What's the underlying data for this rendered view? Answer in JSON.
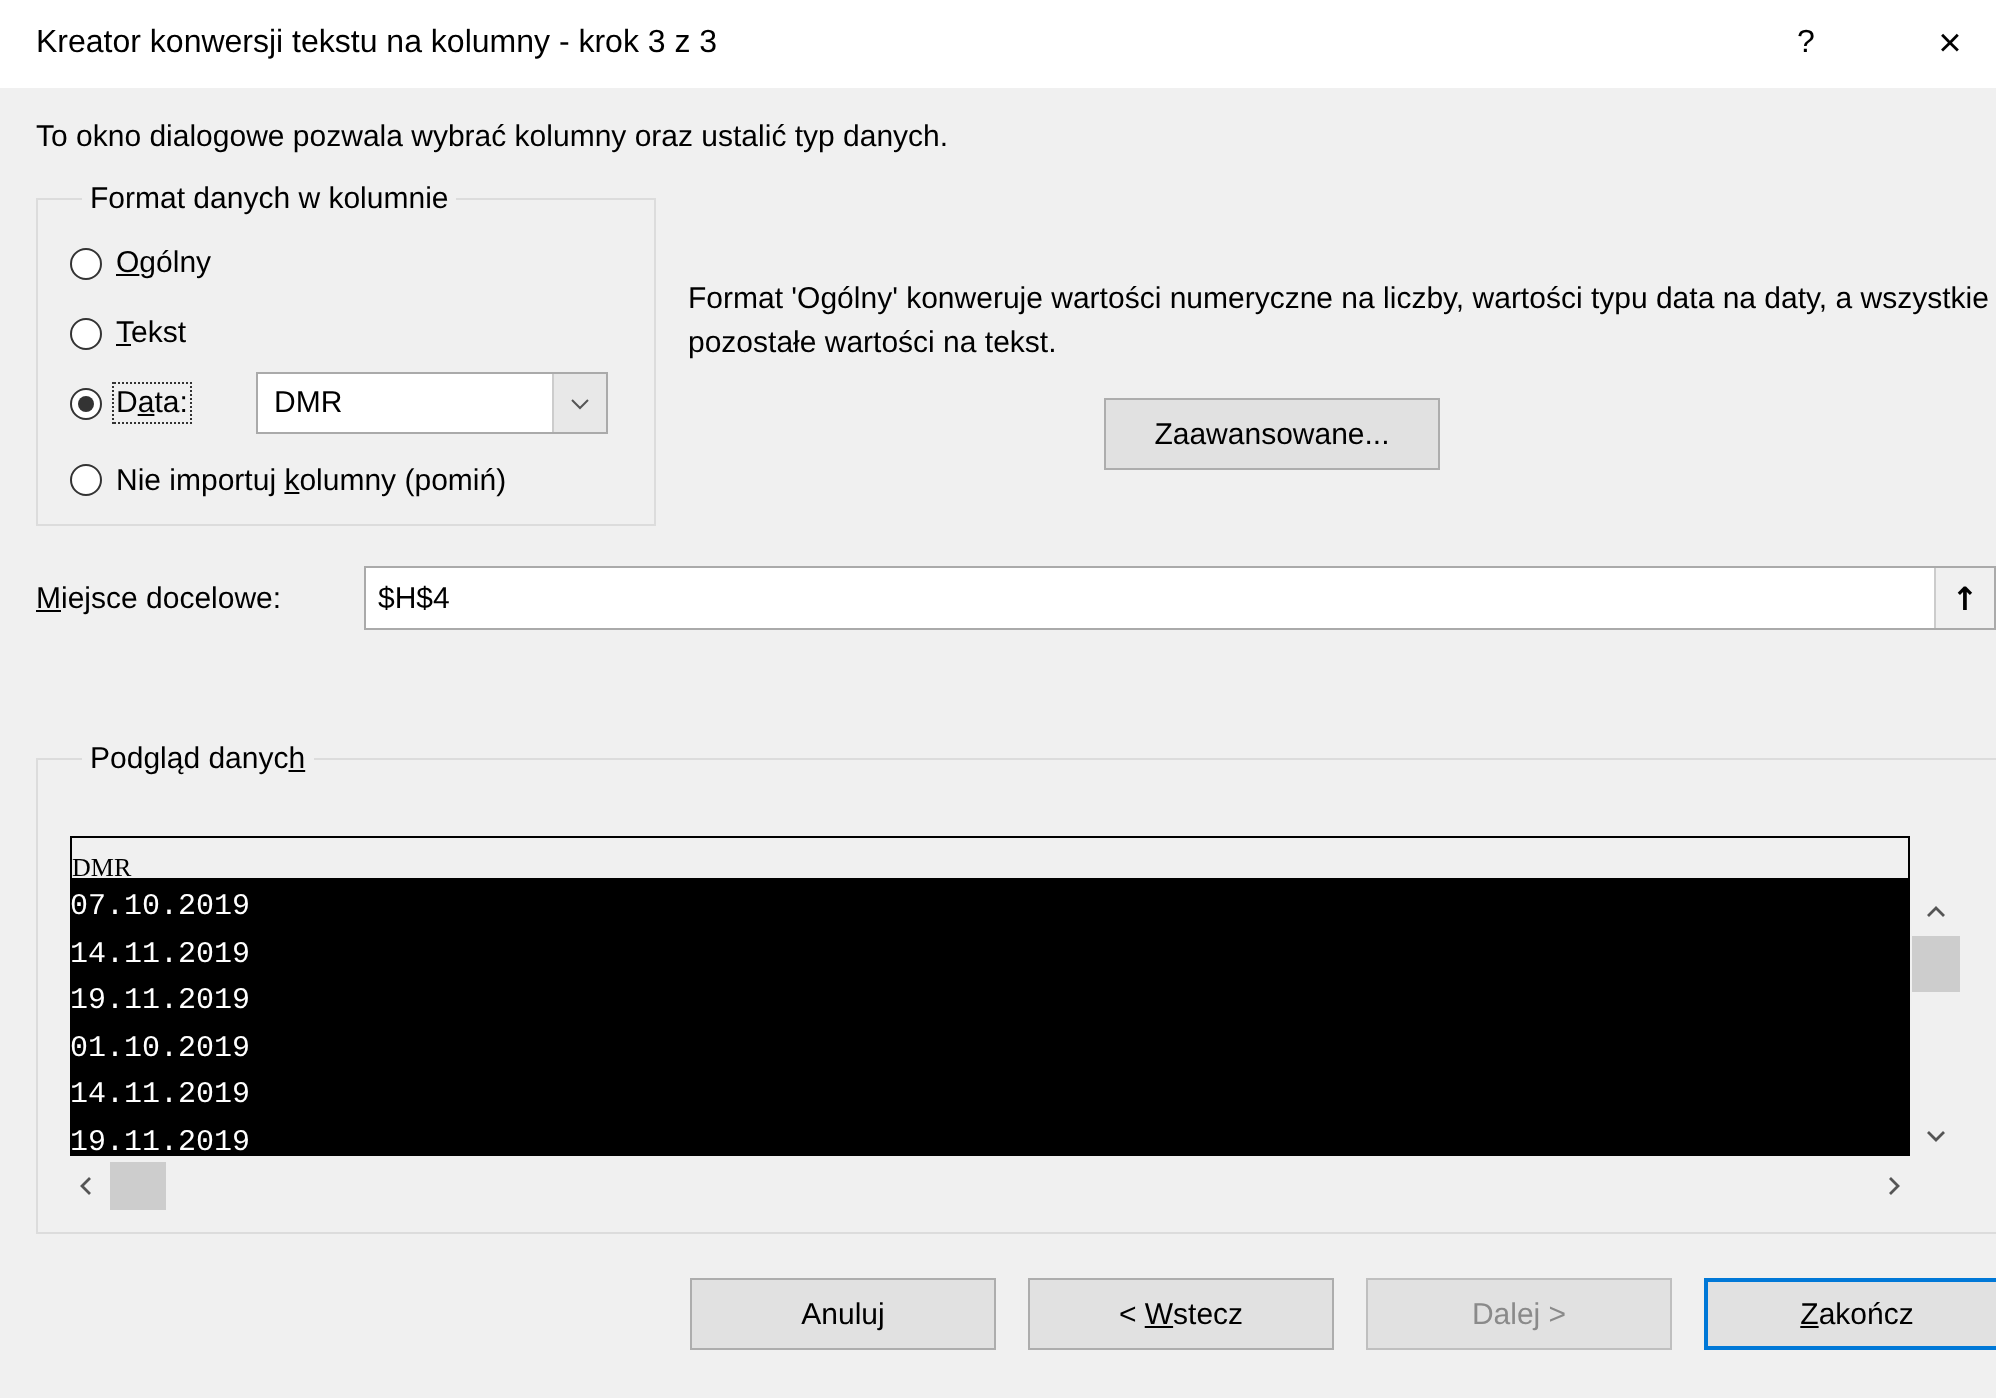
{
  "window": {
    "title": "Kreator konwersji tekstu na kolumny - krok 3 z 3",
    "help": "?",
    "close": "×"
  },
  "intro": "To okno dialogowe pozwala wybrać kolumny oraz ustalić typ danych.",
  "format_group": {
    "title": "Format danych w kolumnie",
    "options": [
      {
        "label": [
          {
            "text": "O",
            "underline": true
          },
          {
            "text": "gólny",
            "underline": false
          }
        ],
        "selected": false
      },
      {
        "label": [
          {
            "text": "T",
            "underline": true
          },
          {
            "text": "ekst",
            "underline": false
          }
        ],
        "selected": false
      },
      {
        "label": [
          {
            "text": "D",
            "underline": false
          },
          {
            "text": "a",
            "underline": true
          },
          {
            "text": "ta:",
            "underline": false
          }
        ],
        "selected": true,
        "focused": true
      },
      {
        "label": [
          {
            "text": "Nie importuj ",
            "underline": false
          },
          {
            "text": "k",
            "underline": true
          },
          {
            "text": "olumny (pomiń)",
            "underline": false
          }
        ],
        "selected": false
      }
    ],
    "date_format": "DMR"
  },
  "description": "Format 'Ogólny' konweruje wartości numeryczne na liczby, wartości typu data na daty, a wszystkie pozostałe wartości na tekst.",
  "advanced_button": "Zaawansowane...",
  "destination": {
    "label": [
      {
        "text": "M",
        "underline": true
      },
      {
        "text": "iejsce docelowe:",
        "underline": false
      }
    ],
    "value": "$H$4",
    "collapse_icon": "↑"
  },
  "preview": {
    "title": [
      {
        "text": "Podgląd danyc",
        "underline": false
      },
      {
        "text": "h",
        "underline": true
      }
    ],
    "header": "DMR",
    "rows": [
      "07.10.2019",
      "14.11.2019",
      "19.11.2019",
      "01.10.2019",
      "14.11.2019",
      "19.11.2019"
    ]
  },
  "buttons": [
    {
      "label": [
        {
          "text": "Anuluj",
          "underline": false
        }
      ],
      "disabled": false,
      "default": false
    },
    {
      "label": [
        {
          "text": "< ",
          "underline": false
        },
        {
          "text": "W",
          "underline": true
        },
        {
          "text": "stecz",
          "underline": false
        }
      ],
      "disabled": false,
      "default": false
    },
    {
      "label": [
        {
          "text": "Dalej >",
          "underline": false
        }
      ],
      "disabled": true,
      "default": false
    },
    {
      "label": [
        {
          "text": "Z",
          "underline": true
        },
        {
          "text": "akończ",
          "underline": false
        }
      ],
      "disabled": false,
      "default": true
    }
  ]
}
